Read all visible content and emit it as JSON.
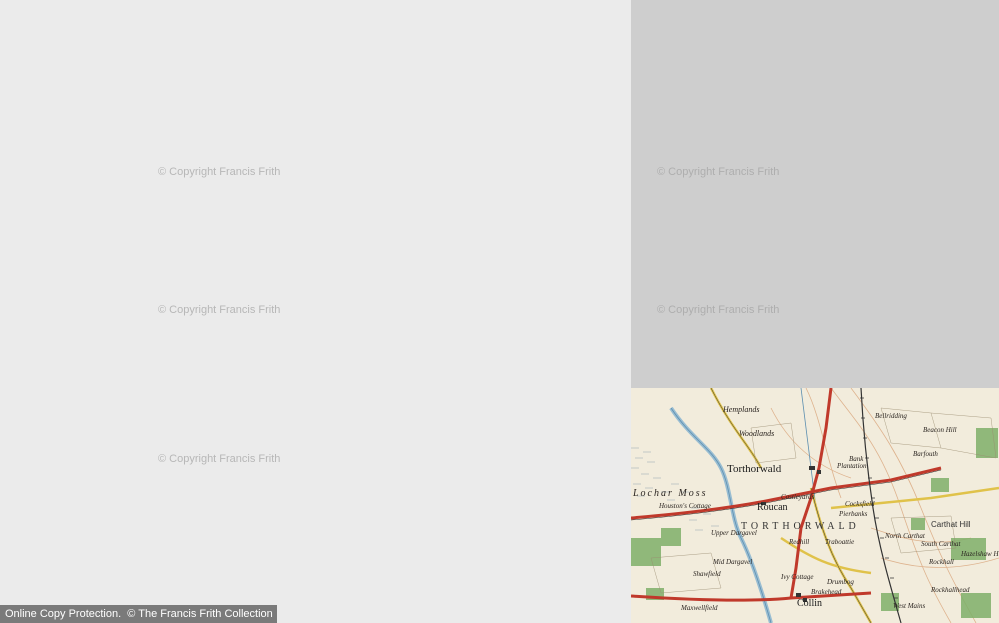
{
  "watermark_text": "© Copyright Francis Frith",
  "footer": {
    "protection": "Online Copy Protection.",
    "collection": "© The Francis Frith Collection"
  },
  "map": {
    "place_names": {
      "hemplands": "Hemplands",
      "woodlands": "Woodlands",
      "tinwald_bank": "Bank",
      "plantation": "Plantation",
      "torthorwald": "Torthorwald",
      "lochar_moss": "Lochar Moss",
      "roucan": "Roucan",
      "castleyards": "Castleyards",
      "torthorwald_parish": "TORTHORWALD",
      "housestoft_cottage": "Houston's Cottage",
      "upper_dargavel": "Upper Dargavel",
      "mid_dargavel": "Mid Dargavel",
      "shawfield": "Shawfield",
      "collin": "Collin",
      "brakehead": "Brakehead",
      "drumbog": "Drumbog",
      "maxwellfield": "Maxwellfield",
      "west_mains": "West Mains",
      "rockhall": "Rockhall",
      "rockhallhead": "Rockhallhead",
      "hazelshaw_hill": "Hazelshaw Hill",
      "carthat_hill": "Carthat Hill",
      "bellridding": "Bellridding",
      "barfouth": "Barfouth",
      "cockersfield": "Cocksfield",
      "pierbanks": "Pierbanks",
      "north_carthat": "North Carthat",
      "south_carthat": "South Carthat",
      "redhill": "Redhill",
      "traboattie": "Traboattie",
      "ivy_cottage": "Ivy Cottage",
      "beacon_hill": "Beacon Hill"
    },
    "colors": {
      "paper": "#f2ecdc",
      "road_red": "#c0392b",
      "road_yellow": "#e0c24a",
      "water": "#8fb8d0",
      "wood": "#7fb069",
      "contour": "#d9a47a"
    }
  }
}
